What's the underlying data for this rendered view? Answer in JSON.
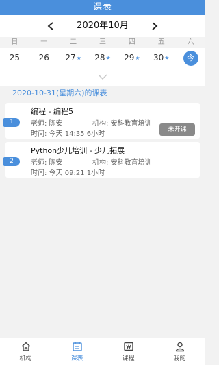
{
  "header": {
    "title": "课表"
  },
  "calendar": {
    "month_label": "2020年10月",
    "weekdays": [
      "日",
      "一",
      "二",
      "三",
      "四",
      "五",
      "六"
    ],
    "days": [
      {
        "num": "25",
        "star": ""
      },
      {
        "num": "26",
        "star": ""
      },
      {
        "num": "27",
        "star": "★"
      },
      {
        "num": "28",
        "star": "★"
      },
      {
        "num": "29",
        "star": "★"
      },
      {
        "num": "30",
        "star": "★"
      },
      {
        "num": "今",
        "today": true
      }
    ]
  },
  "schedule": {
    "heading": "2020-10-31(星期六)的课表",
    "courses": [
      {
        "index": "1",
        "title": "编程 - 编程5",
        "teacher": "老师: 陈安",
        "org": "机构:  安科教育培训",
        "time": "时间: 今天 14:35   6小时",
        "status": "未开课"
      },
      {
        "index": "2",
        "title": "Python少儿培训 - 少儿拓展",
        "teacher": "老师: 陈安",
        "org": "机构:  安科教育培训",
        "time": "时间: 今天 09:21   1小时"
      }
    ]
  },
  "nav": {
    "items": [
      {
        "label": "机构",
        "icon": "home-icon"
      },
      {
        "label": "课表",
        "icon": "calendar-icon",
        "active": true
      },
      {
        "label": "课程",
        "icon": "course-icon"
      },
      {
        "label": "我的",
        "icon": "user-icon"
      }
    ]
  },
  "colors": {
    "accent": "#4a8fdc",
    "status_btn": "#8a8a8a"
  }
}
